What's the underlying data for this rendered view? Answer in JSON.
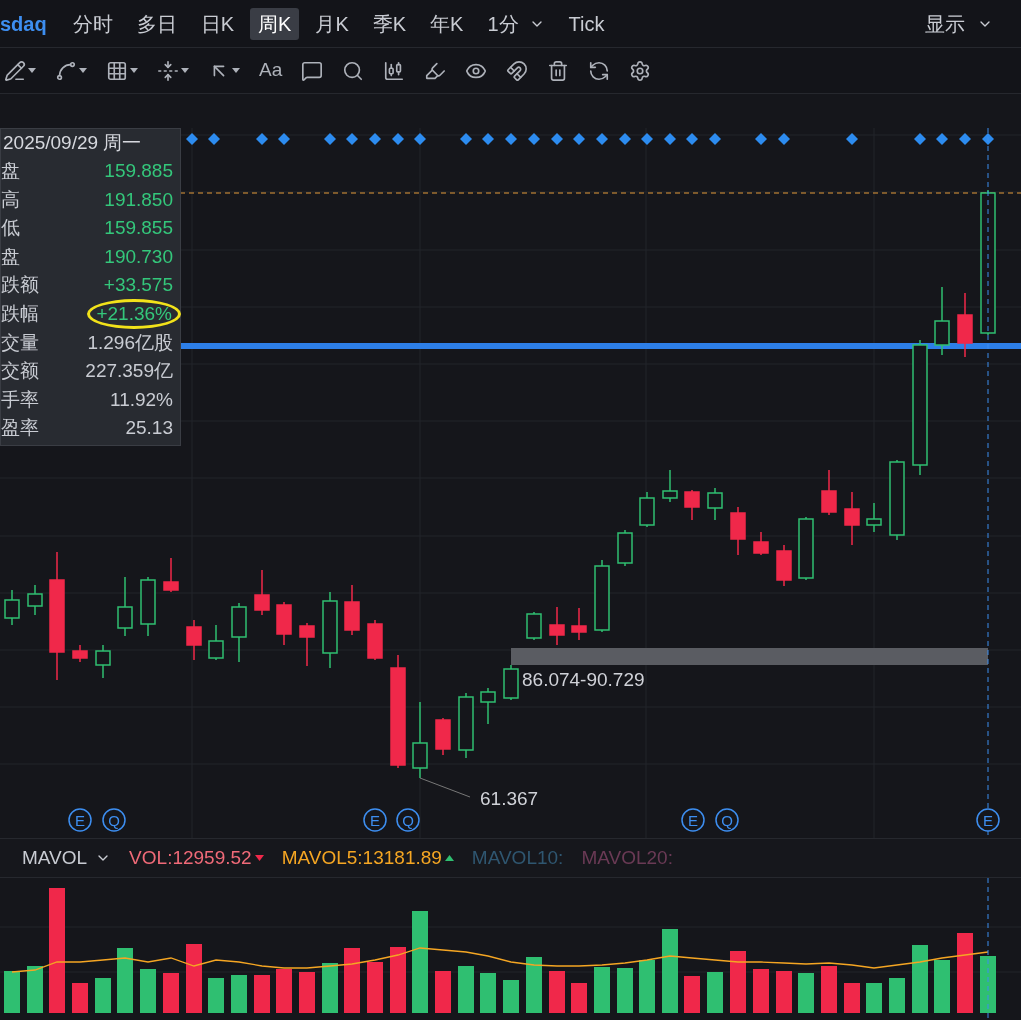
{
  "symbol": "sdaq",
  "tabs": [
    {
      "label": "分时",
      "selected": false,
      "kind": "tab"
    },
    {
      "label": "多日",
      "selected": false,
      "kind": "tab"
    },
    {
      "label": "日K",
      "selected": false,
      "kind": "tab"
    },
    {
      "label": "周K",
      "selected": true,
      "kind": "tab"
    },
    {
      "label": "月K",
      "selected": false,
      "kind": "tab"
    },
    {
      "label": "季K",
      "selected": false,
      "kind": "tab"
    },
    {
      "label": "年K",
      "selected": false,
      "kind": "tab"
    },
    {
      "label": "1分",
      "selected": false,
      "kind": "dropdown"
    },
    {
      "label": "Tick",
      "selected": false,
      "kind": "tab"
    }
  ],
  "display_menu": {
    "label": "显示"
  },
  "toolbar": [
    {
      "kind": "icon",
      "caret": true
    },
    {
      "kind": "icon",
      "caret": true
    },
    {
      "kind": "icon",
      "caret": true
    },
    {
      "kind": "icon",
      "caret": true
    },
    {
      "kind": "icon",
      "caret": true
    },
    {
      "kind": "text",
      "label": "Aa",
      "caret": false
    },
    {
      "kind": "icon",
      "caret": false
    },
    {
      "kind": "icon",
      "caret": false
    },
    {
      "kind": "icon",
      "caret": false
    },
    {
      "kind": "icon",
      "caret": false
    },
    {
      "kind": "icon",
      "caret": false
    },
    {
      "kind": "icon",
      "caret": false
    },
    {
      "kind": "icon",
      "caret": false
    },
    {
      "kind": "icon",
      "caret": false
    },
    {
      "kind": "icon",
      "caret": false
    }
  ],
  "info_panel": {
    "date": "2025/09/29 周一",
    "rows": [
      {
        "label": "盘",
        "value": "159.885",
        "color": "#34c77b",
        "highlighted": false
      },
      {
        "label": "高",
        "value": "191.850",
        "color": "#34c77b",
        "highlighted": false
      },
      {
        "label": "低",
        "value": "159.855",
        "color": "#34c77b",
        "highlighted": false
      },
      {
        "label": "盘",
        "value": "190.730",
        "color": "#34c77b",
        "highlighted": false
      },
      {
        "label": "跌额",
        "value": "+33.575",
        "color": "#34c77b",
        "highlighted": false
      },
      {
        "label": "跌幅",
        "value": "+21.36%",
        "color": "#34c77b",
        "highlighted": true
      },
      {
        "label": "交量",
        "value": "1.296亿股",
        "color": "#c9ccd3",
        "highlighted": false
      },
      {
        "label": "交额",
        "value": "227.359亿",
        "color": "#c9ccd3",
        "highlighted": false
      },
      {
        "label": "手率",
        "value": "11.92%",
        "color": "#c9ccd3",
        "highlighted": false
      },
      {
        "label": "盈率",
        "value": "25.13",
        "color": "#c9ccd3",
        "highlighted": false
      }
    ]
  },
  "chart_labels": {
    "range": "86.074-90.729",
    "low": "61.367"
  },
  "events": [
    {
      "label": "E"
    },
    {
      "label": "Q"
    },
    {
      "label": "E"
    },
    {
      "label": "Q"
    },
    {
      "label": "E"
    },
    {
      "label": "Q"
    },
    {
      "label": "E"
    }
  ],
  "volume_legend": {
    "indicator": "MAVOL",
    "items": [
      {
        "label": "VOL:12959.52",
        "color": "#f06a78",
        "kind": "down"
      },
      {
        "label": "MAVOL5:13181.89",
        "color": "#f5a623",
        "kind": "up"
      },
      {
        "label": "MAVOL10:",
        "color": "#2f5670",
        "kind": "plain"
      },
      {
        "label": "MAVOL20:",
        "color": "#6a3a55",
        "kind": "plain"
      }
    ]
  }
}
